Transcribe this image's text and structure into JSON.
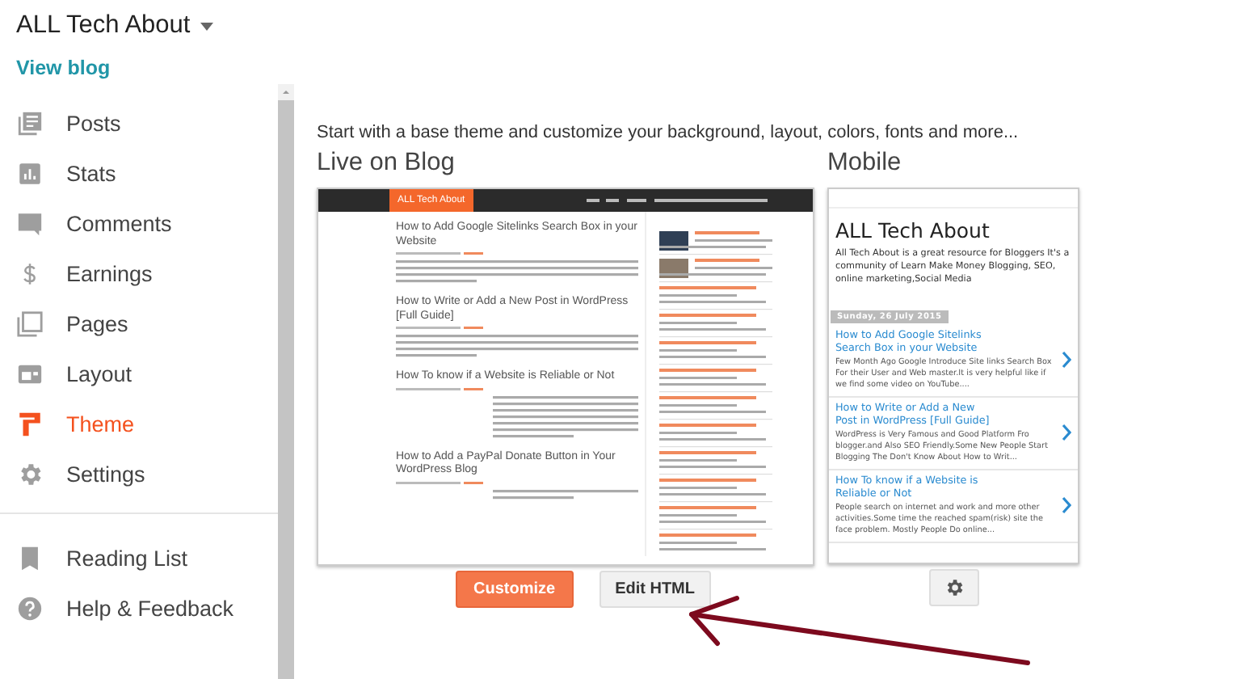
{
  "sidebar": {
    "blog_title": "ALL Tech About",
    "view_blog": "View blog",
    "items": [
      {
        "kind": "posts",
        "label": "Posts",
        "selected": false
      },
      {
        "kind": "stats",
        "label": "Stats",
        "selected": false
      },
      {
        "kind": "comments",
        "label": "Comments",
        "selected": false
      },
      {
        "kind": "earnings",
        "label": "Earnings",
        "selected": false
      },
      {
        "kind": "pages",
        "label": "Pages",
        "selected": false
      },
      {
        "kind": "layout",
        "label": "Layout",
        "selected": false
      },
      {
        "kind": "theme",
        "label": "Theme",
        "selected": true
      },
      {
        "kind": "settings",
        "label": "Settings",
        "selected": false
      }
    ],
    "secondary_items": [
      {
        "kind": "reading",
        "label": "Reading List",
        "selected": false
      },
      {
        "kind": "help",
        "label": "Help & Feedback",
        "selected": false
      }
    ]
  },
  "main": {
    "intro": "Start with a base theme and customize your background, layout, colors, fonts and more...",
    "live": {
      "heading": "Live on Blog",
      "preview": {
        "logo": "ALL Tech About",
        "posts": [
          "How to Add Google Sitelinks Search Box in your Website",
          "How to Write or Add a New Post in WordPress [Full Guide]",
          "How To know if a Website is Reliable or Not",
          "How to Add a PayPal Donate Button in Your WordPress Blog"
        ]
      },
      "buttons": [
        {
          "kind": "primary",
          "label": "Customize"
        },
        {
          "kind": "secondary",
          "label": "Edit HTML"
        }
      ]
    },
    "mobile": {
      "heading": "Mobile",
      "preview": {
        "title": "ALL Tech About",
        "description": "All Tech About is a great resource for Bloggers It's a community of Learn Make Money Blogging, SEO, online marketing,Social Media",
        "date": "Sunday, 26 July 2015",
        "posts": [
          {
            "title": "How to Add Google Sitelinks Search Box in your Website",
            "snippet": "Few Month Ago Google Introduce Site links  Search Box For their User and Web master.It is very helpful like if we find some video on YouTube...."
          },
          {
            "title": "How to Write or Add a New Post in WordPress [Full Guide]",
            "snippet": "WordPress is Very Famous and Good Platform Fro blogger.and Also SEO Friendly.Some New People Start Blogging The Don't Know About How to Writ..."
          },
          {
            "title": "How To know if a Website is Reliable or Not",
            "snippet": "People search on internet and work and more other activities.Some time the reached spam(risk) site the face problem. Mostly People Do online..."
          }
        ]
      }
    }
  }
}
